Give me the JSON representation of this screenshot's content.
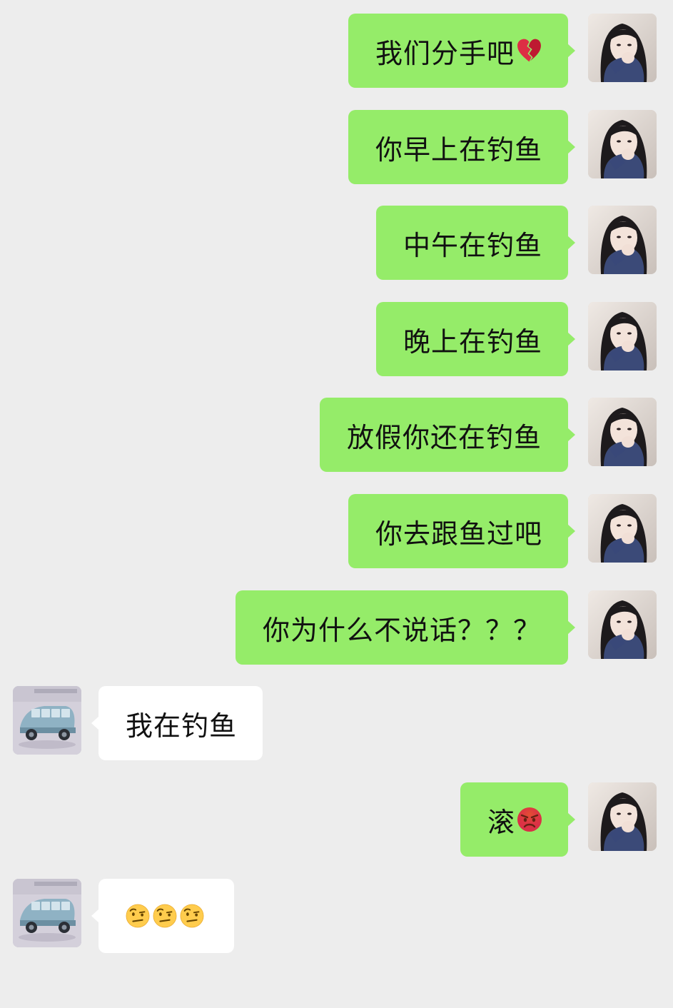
{
  "messages": [
    {
      "side": "right",
      "sender": "girl",
      "text": "我们分手吧",
      "emoji": "broken-heart-icon"
    },
    {
      "side": "right",
      "sender": "girl",
      "text": "你早上在钓鱼"
    },
    {
      "side": "right",
      "sender": "girl",
      "text": "中午在钓鱼"
    },
    {
      "side": "right",
      "sender": "girl",
      "text": "晚上在钓鱼"
    },
    {
      "side": "right",
      "sender": "girl",
      "text": "放假你还在钓鱼"
    },
    {
      "side": "right",
      "sender": "girl",
      "text": "你去跟鱼过吧"
    },
    {
      "side": "right",
      "sender": "girl",
      "text": "你为什么不说话？？？"
    },
    {
      "side": "left",
      "sender": "car",
      "text": "我在钓鱼"
    },
    {
      "side": "right",
      "sender": "girl",
      "text": "滚",
      "emoji": "angry-face-icon"
    },
    {
      "side": "left",
      "sender": "car",
      "text": "",
      "emoji": "raised-eyebrow-face-icon ×3"
    }
  ],
  "colors": {
    "background": "#EDEDED",
    "own_bubble": "#95EC69",
    "other_bubble": "#FFFFFF"
  }
}
